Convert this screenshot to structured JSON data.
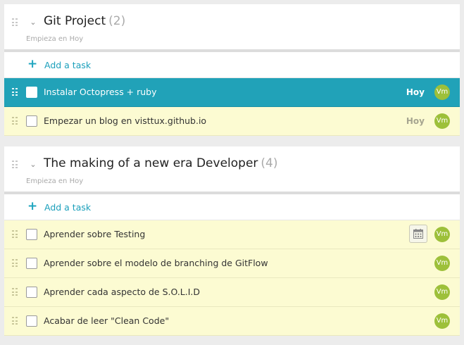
{
  "projects": [
    {
      "title": "Git Project",
      "count": "(2)",
      "starts": "Empieza en Hoy",
      "add_label": "Add a task",
      "tasks": [
        {
          "title": "Instalar Octopress + ruby",
          "due": "Hoy",
          "avatar": "Vm",
          "active": true
        },
        {
          "title": "Empezar un blog en visttux.github.io",
          "due": "Hoy",
          "avatar": "Vm",
          "active": false
        }
      ]
    },
    {
      "title": "The making of a new era Developer",
      "count": "(4)",
      "starts": "Empieza en Hoy",
      "add_label": "Add a task",
      "tasks": [
        {
          "title": "Aprender sobre Testing",
          "avatar": "Vm",
          "icon": "calendar-icon"
        },
        {
          "title": "Aprender sobre el modelo de branching de GitFlow",
          "avatar": "Vm"
        },
        {
          "title": "Aprender cada aspecto de S.O.L.I.D",
          "avatar": "Vm"
        },
        {
          "title": "Acabar de leer \"Clean Code\"",
          "avatar": "Vm"
        }
      ]
    }
  ],
  "colors": {
    "active_row": "#21a2b8",
    "task_row": "#fcfbd2",
    "avatar": "#9dc03a",
    "add_accent": "#1fa5bf"
  }
}
